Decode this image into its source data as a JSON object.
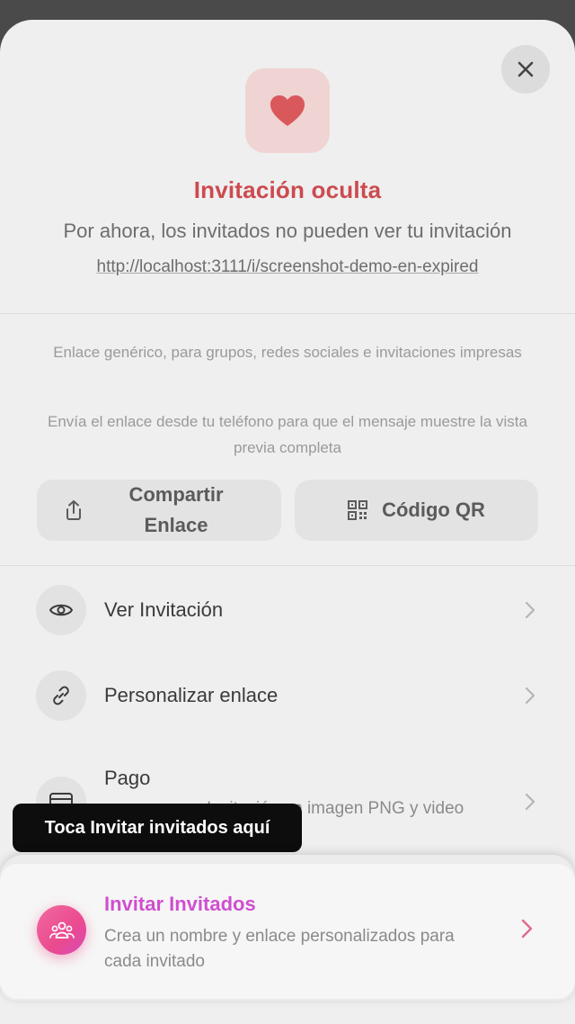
{
  "status": {
    "title": "Invitación oculta",
    "subtitle": "Por ahora, los invitados no pueden ver tu invitación",
    "url": "http://localhost:3111/i/screenshot-demo-en-expired"
  },
  "notes": {
    "generic_link": "Enlace genérico, para grupos, redes sociales e invitaciones impresas",
    "send_from_phone": "Envía el enlace desde tu teléfono para que el mensaje muestre la vista previa completa"
  },
  "actions": {
    "share_line1": "Compartir",
    "share_line2": "Enlace",
    "qr_label": "Código QR"
  },
  "menu": {
    "view_invitation": "Ver Invitación",
    "customize_link": "Personalizar enlace",
    "payment": "Pago",
    "payment_desc": "Invitación en imagen PNG y video"
  },
  "tooltip": "Toca Invitar invitados aquí",
  "invite": {
    "title": "Invitar Invitados",
    "desc": "Crea un nombre y enlace personalizados para cada invitado"
  },
  "colors": {
    "accent_red": "#cc4a50",
    "accent_pink": "#ea4a8e",
    "accent_purple": "#cf4fd0"
  },
  "icons": {
    "close": "close-icon",
    "heart": "heart-icon",
    "share": "share-icon",
    "qr": "qr-code-icon",
    "eye": "eye-icon",
    "link": "link-icon",
    "card": "card-icon",
    "guests": "guests-icon",
    "chevron": "chevron-right-icon"
  }
}
